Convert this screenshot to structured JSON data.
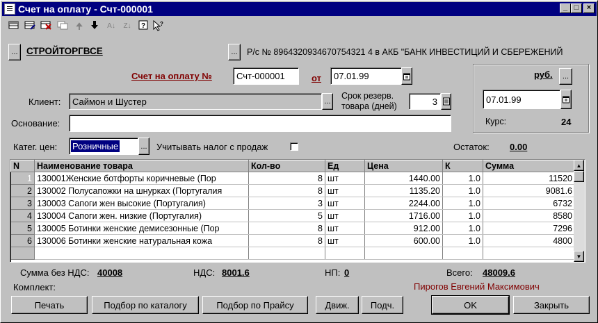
{
  "window": {
    "title": "Счет на оплату - Счт-000001"
  },
  "header": {
    "org_name": "СТРОЙТОРГВСЕ",
    "bank_account": "Р/с № 8964320934670754321 4 в АКБ \"БАНК ИНВЕСТИЦИЙ И СБЕРЕЖЕНИЙ",
    "invoice_label": "Счет на оплату №",
    "invoice_number": "Счт-000001",
    "date_from_label": "от",
    "invoice_date": "07.01.99",
    "client_label": "Клиент:",
    "client_value": "Саймон и Шустер",
    "reserve_label_1": "Срок резерв.",
    "reserve_label_2": "товара (дней)",
    "reserve_days": "3",
    "basis_label": "Основание:",
    "basis_value": "",
    "price_cat_label": "Катег. цен:",
    "price_cat_value": "Розничные",
    "tax_label": "Учитывать налог с продаж",
    "tax_checked": false,
    "balance_label": "Остаток:",
    "balance_value": "0.00"
  },
  "currency": {
    "name": "руб.",
    "date": "07.01.99",
    "rate_label": "Курс:",
    "rate_value": "24"
  },
  "table": {
    "columns": [
      "N",
      "Наименование товара",
      "Кол-во",
      "Ед",
      "Цена",
      "К",
      "Сумма"
    ],
    "rows": [
      {
        "n": "1",
        "name": "130001Женские ботфорты коричневые (Пор",
        "qty": "8",
        "unit": "шт",
        "price": "1440.00",
        "k": "1.0",
        "sum": "11520"
      },
      {
        "n": "2",
        "name": "130002 Полусапожки на шнурках (Португалия",
        "qty": "8",
        "unit": "шт",
        "price": "1135.20",
        "k": "1.0",
        "sum": "9081.6"
      },
      {
        "n": "3",
        "name": "130003 Сапоги жен высокие (Португалия)",
        "qty": "3",
        "unit": "шт",
        "price": "2244.00",
        "k": "1.0",
        "sum": "6732"
      },
      {
        "n": "4",
        "name": "130004 Сапоги жен. низкие (Португалия)",
        "qty": "5",
        "unit": "шт",
        "price": "1716.00",
        "k": "1.0",
        "sum": "8580"
      },
      {
        "n": "5",
        "name": "130005 Ботинки женские демисезонные (Пор",
        "qty": "8",
        "unit": "шт",
        "price": "912.00",
        "k": "1.0",
        "sum": "7296"
      },
      {
        "n": "6",
        "name": "130006 Ботинки женские натуральная кожа",
        "qty": "8",
        "unit": "шт",
        "price": "600.00",
        "k": "1.0",
        "sum": "4800"
      }
    ]
  },
  "totals": {
    "no_vat_label": "Сумма без НДС:",
    "no_vat_value": "40008",
    "vat_label": "НДС:",
    "vat_value": "8001.6",
    "np_label": "НП:",
    "np_value": "0",
    "total_label": "Всего:",
    "total_value": "48009.6"
  },
  "kit_label": "Комплект:",
  "responsible": "Пирогов Евгений Максимович",
  "buttons": {
    "print": "Печать",
    "catalog": "Подбор по каталогу",
    "pricelist": "Подбор по Прайсу",
    "move": "Движ.",
    "sub": "Подч.",
    "ok": "OK",
    "close": "Закрыть",
    "ellipsis": "..."
  },
  "colors": {
    "titlebar": "#000080",
    "accent_red": "#800000",
    "selection": "#000080"
  },
  "icons": [
    "new-row-icon",
    "edit-row-icon",
    "delete-row-icon",
    "copy-row-icon",
    "move-up-icon",
    "move-down-icon",
    "sort-asc-icon",
    "sort-desc-icon",
    "help-icon",
    "context-help-icon"
  ]
}
